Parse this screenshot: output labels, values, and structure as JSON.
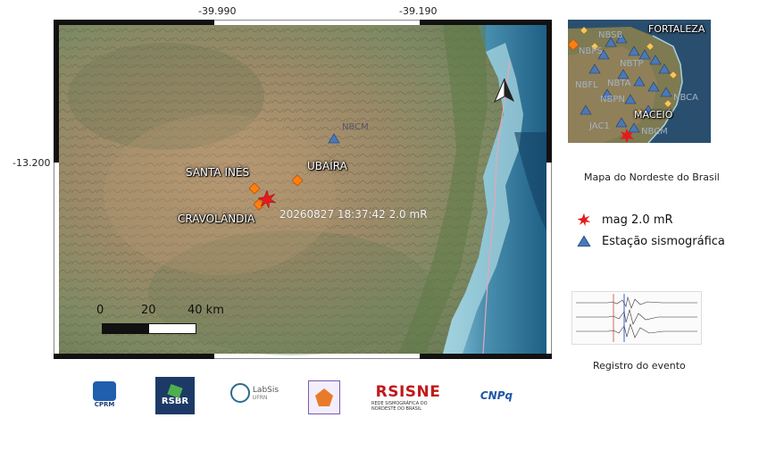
{
  "map": {
    "coords": {
      "lon_ticks": [
        "-39.990",
        "-39.190"
      ],
      "lat_ticks": [
        "-13.200"
      ]
    },
    "cities": {
      "santa_ines": "SANTA INÊS",
      "ubaira": "UBAÍRA",
      "cravolandia": "CRAVOLÂNDIA"
    },
    "station_code": "NBCM",
    "event_label": "20260827 18:37:42 2.0 mR",
    "scale": {
      "n0": "0",
      "n20": "20",
      "n40": "40 km"
    },
    "north_arrow": "north-arrow-icon"
  },
  "inset": {
    "cities": {
      "fortaleza": "FORTALEZA",
      "maceio": "MACEIÓ"
    },
    "station_codes": [
      "NBSB",
      "NBPS",
      "NBTP",
      "NBFL",
      "NBTA",
      "NBPN",
      "JAC1",
      "NBCM",
      "NBCA"
    ],
    "caption": "Mapa do Nordeste do Brasil"
  },
  "legend": {
    "event": "mag 2.0 mR",
    "station": "Estação sismográfica",
    "event_color": "#e41a1c",
    "station_color": "#4a78b8"
  },
  "record": {
    "caption": "Registro do evento"
  },
  "logos": {
    "cprm": "CPRM",
    "rsbr": "RSBR",
    "labsis": "LabSis",
    "labsis_sub": "UFRN",
    "rsisne": "RSISNE",
    "rsisne_sub": "REDE SISMOGRÁFICA DO NORDESTE DO BRASIL",
    "cnpq": "CNPq"
  }
}
